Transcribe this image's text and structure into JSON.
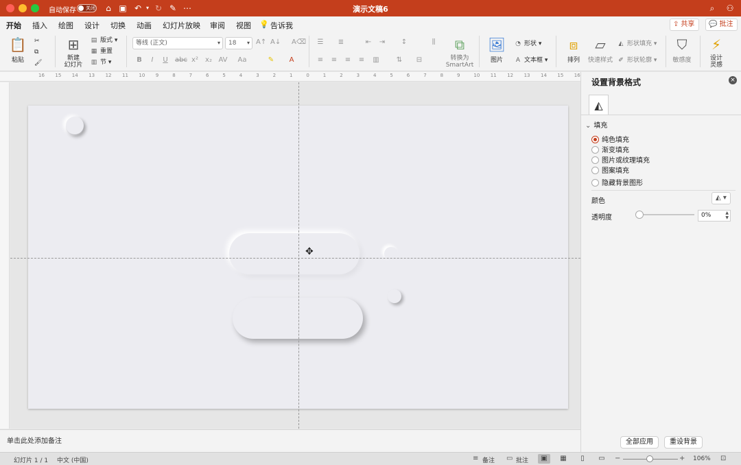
{
  "titlebar": {
    "autosave_label": "自动保存",
    "autosave_state": "关闭",
    "doc_title": "演示文稿6"
  },
  "tabs": [
    "开始",
    "插入",
    "绘图",
    "设计",
    "切换",
    "动画",
    "幻灯片放映",
    "审阅",
    "视图"
  ],
  "tell_me": "告诉我",
  "top_buttons": {
    "share": "共享",
    "comment": "批注"
  },
  "ribbon": {
    "paste": "粘贴",
    "new_slide": "新建\n幻灯片",
    "layout": "版式",
    "reset": "重置",
    "section": "节",
    "font_name": "等线 (正文)",
    "font_size": "18",
    "convert_smartart": "转换为\nSmartArt",
    "picture": "图片",
    "shape": "形状",
    "textbox": "文本框",
    "arrange": "排列",
    "quick_styles": "快速样式",
    "shape_fill": "形状填充",
    "shape_outline": "形状轮廓",
    "sensitivity": "敏感度",
    "designer": "设计\n灵感"
  },
  "ruler_numbers": [
    "16",
    "15",
    "14",
    "13",
    "12",
    "11",
    "10",
    "9",
    "8",
    "7",
    "6",
    "5",
    "4",
    "3",
    "2",
    "1",
    "0",
    "1",
    "2",
    "3",
    "4",
    "5",
    "6",
    "7",
    "8",
    "9",
    "10",
    "11",
    "12",
    "13",
    "14",
    "15",
    "16"
  ],
  "notes_placeholder": "单击此处添加备注",
  "pane": {
    "title": "设置背景格式",
    "section": "填充",
    "fill_options": [
      "纯色填充",
      "渐变填充",
      "图片或纹理填充",
      "图案填充"
    ],
    "selected_fill": "纯色填充",
    "hide_bg": "隐藏背景图形",
    "color_label": "颜色",
    "transparency_label": "透明度",
    "transparency_value": "0%",
    "transparency_level": 0,
    "apply_all": "全部应用",
    "reset_bg": "重设背景"
  },
  "status": {
    "slide_info": "幻灯片 1 / 1",
    "language": "中文 (中国)",
    "notes": "备注",
    "comments": "批注",
    "zoom": "106%"
  },
  "colors": {
    "accent": "#c43e1c",
    "slide_bg": "#ececf1"
  }
}
